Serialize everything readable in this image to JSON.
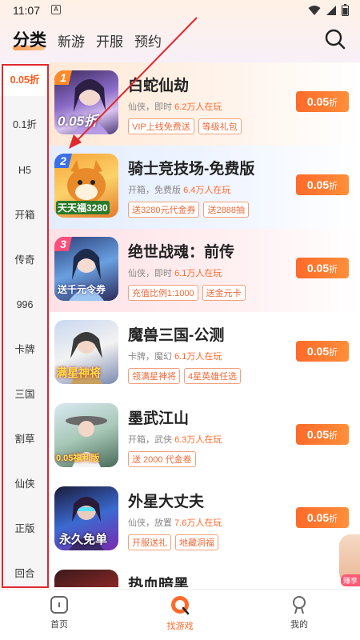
{
  "status": {
    "time": "11:07",
    "notif_icon": "A"
  },
  "topnav": {
    "tabs": [
      {
        "label": "分类"
      },
      {
        "label": "新游"
      },
      {
        "label": "开服"
      },
      {
        "label": "预约"
      }
    ]
  },
  "sidebar": {
    "items": [
      {
        "label": "0.05折"
      },
      {
        "label": "0.1折"
      },
      {
        "label": "H5"
      },
      {
        "label": "开箱"
      },
      {
        "label": "传奇"
      },
      {
        "label": "996"
      },
      {
        "label": "卡牌"
      },
      {
        "label": "三国"
      },
      {
        "label": "割草"
      },
      {
        "label": "仙侠"
      },
      {
        "label": "正版"
      },
      {
        "label": "回合"
      }
    ]
  },
  "games": [
    {
      "rank": "1",
      "name": "白蛇仙劫",
      "meta_prefix": "仙侠，即时",
      "players": "6.2万人在玩",
      "tags": [
        "VIP上线免费送",
        "等级礼包"
      ],
      "price": "0.05",
      "price_unit": "折",
      "icon_text": "0.05折",
      "rank_color": "#ff8a2a"
    },
    {
      "rank": "2",
      "name": "骑士竞技场-免费版",
      "meta_prefix": "开箱，免费版",
      "players": "6.4万人在玩",
      "tags": [
        "送3280元代金券",
        "送2888抽"
      ],
      "price": "0.05",
      "price_unit": "折",
      "icon_text": "天天福3280",
      "rank_color": "#3a6fe6"
    },
    {
      "rank": "3",
      "name": "绝世战魂：前传",
      "meta_prefix": "仙侠，即时",
      "players": "6.1万人在玩",
      "tags": [
        "充值比例1:1000",
        "送金元卡"
      ],
      "price": "0.05",
      "price_unit": "折",
      "icon_text": "送千元令券",
      "rank_color": "#ff4f7a"
    },
    {
      "rank": "",
      "name": "魔兽三国-公测",
      "meta_prefix": "卡牌，魔幻",
      "players": "6.1万人在玩",
      "tags": [
        "领满星神将",
        "4星英雄任选"
      ],
      "price": "0.05",
      "price_unit": "折",
      "icon_text": "满星神将",
      "rank_color": ""
    },
    {
      "rank": "",
      "name": "墨武江山",
      "meta_prefix": "开箱，武侠",
      "players": "6.3万人在玩",
      "tags": [
        "送 2000 代金卷"
      ],
      "price": "0.05",
      "price_unit": "折",
      "icon_text": "0.05福利版",
      "rank_color": ""
    },
    {
      "rank": "",
      "name": "外星大丈夫",
      "meta_prefix": "仙侠，放置",
      "players": "7.6万人在玩",
      "tags": [
        "开服送礼",
        "地藏洞福"
      ],
      "price": "0.05",
      "price_unit": "折",
      "icon_text": "永久免单",
      "rank_color": ""
    },
    {
      "rank": "",
      "name": "热血暗黑",
      "meta_prefix": "",
      "players": "",
      "tags": [],
      "price": "",
      "price_unit": "",
      "icon_text": "",
      "rank_color": ""
    }
  ],
  "bottomnav": {
    "items": [
      {
        "label": "首页"
      },
      {
        "label": "找游戏"
      },
      {
        "label": "我的"
      }
    ]
  },
  "float": {
    "tag": "赚享"
  },
  "colors": {
    "accent": "#ff6a2a",
    "highlight": "#e0282e"
  }
}
